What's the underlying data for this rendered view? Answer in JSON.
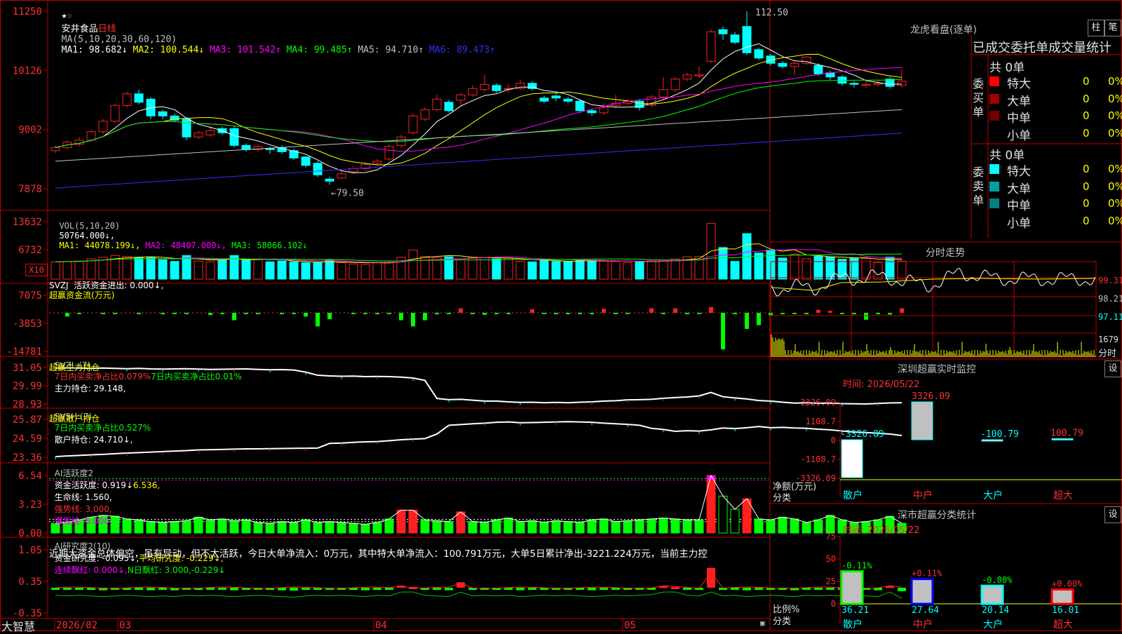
{
  "app": {
    "brand": "大智慧",
    "star_icon": "star-icon"
  },
  "main_chart": {
    "stock_name": "安井食品",
    "period": "日线",
    "ma_params": "MA(5,10,20,30,60,120)",
    "ma": [
      {
        "label": "MA1: 98.682↓",
        "color": "#ffffff"
      },
      {
        "label": "MA2: 100.544↓",
        "color": "#ffff00"
      },
      {
        "label": "MA3: 101.542↑",
        "color": "#ff00ff"
      },
      {
        "label": "MA4: 99.485↑",
        "color": "#00ff00"
      },
      {
        "label": "MA5: 94.710↑",
        "color": "#c0c0c0"
      },
      {
        "label": "MA6: 89.473↑",
        "color": "#3030ff"
      }
    ],
    "y_ticks": [
      "11250",
      "10126",
      "9002",
      "7878"
    ],
    "high_label": "112.50",
    "low_label": "←79.50",
    "colors": {
      "up": "#ff2020",
      "down": "#00ffff"
    }
  },
  "vol_panel": {
    "title": "VOL(5,10,20)",
    "value": "50764.000↓,",
    "ma": [
      {
        "label": "MA1: 44078.199↓,",
        "color": "#ffff00"
      },
      {
        "label": "MA2: 48407.000↓,",
        "color": "#ff00ff"
      },
      {
        "label": "MA3: 58066.102↓",
        "color": "#00ff00"
      }
    ],
    "y_ticks": [
      "13632",
      "6732"
    ],
    "unit": "X10"
  },
  "svzj_panel": {
    "title": "SVZJ  活跃资金进出: 0.000↓,",
    "subtitle": "超赢资金流(万元)",
    "y_ticks": [
      "7075",
      "-3853",
      "-14781"
    ]
  },
  "svzl_panel": {
    "prefix": "SVZL (7)",
    "a": "7日内买卖净占比0.079%",
    "b": "7日内买卖净占比0.01%",
    "c": "主力持仓: 29.148,",
    "subtitle": "超赢主力持仓",
    "y_ticks": [
      "31.05",
      "29.99",
      "28.93"
    ]
  },
  "svsh_panel": {
    "prefix": "SVSH (7)",
    "a": "7日内买卖净占比0.527%",
    "c": "散户持仓: 24.710↓,",
    "subtitle": "超赢散户持仓",
    "y_ticks": [
      "25.87",
      "24.59",
      "23.36"
    ]
  },
  "ai_active_panel": {
    "prefix": "AI活跃度2",
    "a": "资金活跃度: 0.919↓",
    "b": "6.536,",
    "c": "生命线: 1.560,",
    "d": "强势线: 3.000,",
    "e": "爆发线: 6.000,",
    "y_ticks": [
      "6.54",
      "3.23",
      "0.00"
    ]
  },
  "ai_research_panel": {
    "prefix": "AI研究度2(10)",
    "a": "资金研究度: -0.095↓,",
    "b": "平均研究度: -0.229↓,",
    "c": "连续飘红: 0.000↓,",
    "d": "N日飘红: 3.000,",
    "e": "-0.229↓",
    "comment": "近期大资金总体偏空，虽有异动，但不太活跃，今日大单净流入：0万元，其中特大单净流入：100.791万元，大单5日累计净出-3221.224万元，当前主力控",
    "y_ticks": [
      "1.05",
      "0.35",
      "-0.35"
    ]
  },
  "x_axis": {
    "labels": [
      "2026/02",
      "03",
      "04",
      "05"
    ]
  },
  "dragon_tiger": {
    "title": "龙虎看盘(逐单)",
    "btn_a": "柱",
    "btn_b": "笔",
    "header": "已成交委托单成交量统计",
    "buy_title": "委买单",
    "sell_title": "委卖单",
    "buy_total": "共 0单",
    "sell_total": "共 0单",
    "buy_rows": [
      {
        "label": "特大",
        "color": "#ff0000",
        "v": "0",
        "p": "0%"
      },
      {
        "label": "大单",
        "color": "#a00000",
        "v": "0",
        "p": "0%"
      },
      {
        "label": "中单",
        "color": "#700000",
        "v": "0",
        "p": "0%"
      },
      {
        "label": "小单",
        "color": "",
        "v": "0",
        "p": "0%"
      }
    ],
    "sell_rows": [
      {
        "label": "特大",
        "color": "#00ffff",
        "v": "0",
        "p": "0%"
      },
      {
        "label": "大单",
        "color": "#00a0a0",
        "v": "0",
        "p": "0%"
      },
      {
        "label": "中单",
        "color": "#008080",
        "v": "0",
        "p": "0%"
      },
      {
        "label": "小单",
        "color": "",
        "v": "0",
        "p": "0%"
      }
    ]
  },
  "intraday": {
    "title": "分时走势",
    "y_ticks": [
      "99.31",
      "98.21",
      "97.11"
    ],
    "vol_label": "1679",
    "vol_unit": "分时"
  },
  "sz_monitor": {
    "title": "深圳超赢实时监控",
    "btn": "设",
    "time": "时间: 2026/05/22",
    "y_ticks": [
      "3326.09",
      "1108.7",
      "0",
      "-1108.7",
      "-3326.09"
    ],
    "bars": [
      {
        "name": "散户",
        "value": -3326.09,
        "label": "-3326.09"
      },
      {
        "name": "中户",
        "value": 3326.09,
        "label": "3326.09"
      },
      {
        "name": "大户",
        "value": -100.79,
        "label": "-100.79"
      },
      {
        "name": "超大",
        "value": 100.79,
        "label": "100.79"
      }
    ],
    "ylabel": "净额(万元)",
    "xlabel": "分类"
  },
  "sz_class": {
    "title": "深市超赢分类统计",
    "btn": "设",
    "time": "时间: 2026/05/22",
    "y_ticks": [
      "75",
      "50",
      "25",
      "0"
    ],
    "bars": [
      {
        "name": "散户",
        "value": 36.21,
        "label": "36.21",
        "delta": "-0.11%",
        "color": "#00ff00"
      },
      {
        "name": "中户",
        "value": 27.64,
        "label": "27.64",
        "delta": "+0.11%",
        "color": "#0000ff"
      },
      {
        "name": "大户",
        "value": 20.14,
        "label": "20.14",
        "delta": "-0.00%",
        "color": "#00ffff"
      },
      {
        "name": "超大",
        "value": 16.01,
        "label": "16.01",
        "delta": "+0.00%",
        "color": "#ff0000"
      }
    ],
    "ylabel": "比例%",
    "xlabel": "分类"
  },
  "chart_data": [
    {
      "type": "candlestick",
      "title": "安井食品 日线",
      "ylim": [
        7878,
        11250
      ],
      "candles": [
        [
          86.0,
          86.6,
          87.0,
          85.6
        ],
        [
          86.6,
          87.6,
          88.0,
          86.2
        ],
        [
          87.2,
          88.0,
          88.6,
          86.8
        ],
        [
          88.0,
          89.6,
          90.0,
          87.6
        ],
        [
          89.6,
          91.6,
          92.0,
          89.2
        ],
        [
          91.6,
          94.6,
          95.0,
          91.2
        ],
        [
          94.6,
          96.8,
          97.2,
          94.2
        ],
        [
          96.8,
          95.2,
          97.6,
          94.8
        ],
        [
          95.8,
          92.6,
          96.2,
          92.0
        ],
        [
          93.4,
          92.6,
          93.8,
          92.0
        ],
        [
          92.6,
          91.8,
          93.0,
          91.4
        ],
        [
          92.0,
          88.6,
          92.4,
          88.0
        ],
        [
          88.6,
          89.4,
          89.8,
          88.2
        ],
        [
          89.0,
          89.8,
          90.6,
          88.6
        ],
        [
          90.2,
          89.4,
          90.6,
          89.0
        ],
        [
          90.2,
          87.0,
          90.6,
          86.6
        ],
        [
          87.0,
          86.2,
          87.4,
          85.8
        ],
        [
          86.2,
          86.8,
          87.2,
          85.8
        ],
        [
          86.4,
          86.2,
          86.8,
          85.4
        ],
        [
          86.6,
          85.8,
          87.0,
          85.4
        ],
        [
          86.0,
          84.6,
          86.4,
          84.2
        ],
        [
          84.8,
          83.2,
          85.0,
          82.8
        ],
        [
          83.6,
          81.4,
          84.0,
          81.0
        ],
        [
          80.6,
          80.2,
          81.0,
          79.5
        ],
        [
          80.8,
          81.6,
          82.2,
          80.6
        ],
        [
          82.0,
          82.6,
          83.0,
          81.6
        ],
        [
          82.6,
          83.4,
          83.8,
          82.2
        ],
        [
          83.6,
          84.0,
          84.4,
          83.2
        ],
        [
          84.4,
          86.8,
          87.2,
          84.0
        ],
        [
          87.0,
          88.6,
          89.0,
          86.6
        ],
        [
          89.4,
          92.6,
          93.0,
          89.0
        ],
        [
          92.0,
          93.8,
          94.2,
          91.6
        ],
        [
          93.8,
          95.8,
          96.6,
          93.4
        ],
        [
          95.2,
          93.6,
          95.6,
          93.2
        ],
        [
          95.6,
          96.6,
          97.0,
          94.6
        ],
        [
          96.6,
          97.8,
          98.4,
          96.2
        ],
        [
          97.6,
          98.6,
          100.4,
          97.2
        ],
        [
          98.4,
          97.4,
          98.8,
          97.0
        ],
        [
          97.8,
          97.8,
          98.6,
          97.0
        ],
        [
          97.8,
          98.8,
          99.4,
          97.6
        ],
        [
          98.8,
          97.8,
          99.2,
          97.4
        ],
        [
          96.0,
          95.4,
          96.4,
          95.0
        ],
        [
          96.4,
          96.0,
          96.8,
          95.4
        ],
        [
          95.8,
          95.4,
          96.2,
          95.0
        ],
        [
          95.4,
          93.6,
          95.8,
          93.2
        ],
        [
          93.6,
          93.2,
          94.0,
          92.6
        ],
        [
          93.2,
          94.2,
          95.0,
          92.8
        ],
        [
          94.6,
          95.0,
          96.6,
          94.0
        ],
        [
          95.0,
          95.4,
          95.8,
          94.6
        ],
        [
          95.4,
          94.2,
          95.8,
          93.6
        ],
        [
          94.6,
          96.2,
          96.6,
          94.2
        ],
        [
          96.2,
          97.6,
          100.0,
          95.8
        ],
        [
          97.6,
          99.6,
          100.0,
          97.2
        ],
        [
          99.6,
          100.4,
          100.8,
          99.2
        ],
        [
          100.2,
          100.4,
          102.0,
          99.8
        ],
        [
          103.0,
          108.6,
          109.0,
          102.6
        ],
        [
          109.0,
          108.2,
          109.6,
          107.0
        ],
        [
          108.0,
          106.6,
          108.6,
          106.2
        ],
        [
          109.6,
          104.6,
          112.5,
          104.2
        ],
        [
          105.2,
          103.6,
          105.6,
          103.2
        ],
        [
          104.0,
          102.6,
          104.4,
          102.2
        ],
        [
          102.6,
          102.0,
          103.0,
          101.6
        ],
        [
          102.0,
          102.6,
          103.0,
          100.4
        ],
        [
          102.6,
          103.8,
          104.0,
          102.2
        ],
        [
          102.2,
          100.6,
          102.6,
          100.2
        ],
        [
          100.8,
          100.0,
          101.2,
          99.4
        ],
        [
          100.0,
          98.8,
          100.4,
          98.4
        ],
        [
          98.8,
          98.6,
          99.2,
          98.0
        ],
        [
          98.4,
          98.6,
          99.2,
          97.8
        ],
        [
          98.6,
          98.8,
          99.4,
          98.2
        ],
        [
          99.6,
          98.2,
          100.0,
          97.8
        ],
        [
          98.4,
          99.2,
          101.4,
          98.0
        ]
      ]
    },
    {
      "type": "bar",
      "title": "VOL",
      "ylim": [
        0,
        13632
      ],
      "values": [
        4100,
        4200,
        4300,
        4800,
        5200,
        5600,
        5400,
        5100,
        5200,
        4600,
        4200,
        5600,
        4300,
        4100,
        4500,
        5600,
        4500,
        4600,
        4100,
        4300,
        4100,
        3900,
        3900,
        4500,
        3900,
        3600,
        3500,
        3900,
        4300,
        5200,
        6900,
        5400,
        5100,
        5300,
        4800,
        5200,
        5100,
        4800,
        5000,
        4200,
        4100,
        4500,
        4200,
        4100,
        4600,
        4400,
        4300,
        4200,
        3900,
        4200,
        4300,
        4500,
        4800,
        5300,
        5400,
        13200,
        7500,
        4200,
        10800,
        6200,
        6900,
        5000,
        5900,
        4800,
        5400,
        5300,
        4700,
        5000,
        4900,
        3900,
        5200,
        4300
      ]
    },
    {
      "type": "bar",
      "title": "超赢资金流(万元)",
      "ylim": [
        -14781,
        7075
      ],
      "values": [
        0,
        -1500,
        -400,
        0,
        -500,
        -400,
        0,
        -500,
        0,
        -600,
        -400,
        -500,
        0,
        -900,
        -200,
        -3000,
        -400,
        -300,
        0,
        -600,
        -200,
        -1500,
        -5500,
        -2600,
        0,
        -400,
        -300,
        -600,
        -500,
        -3000,
        -5500,
        -3000,
        -600,
        -500,
        1800,
        -500,
        -800,
        -400,
        -500,
        0,
        1400,
        -400,
        -600,
        -300,
        -500,
        -600,
        1600,
        -300,
        -500,
        0,
        1800,
        -400,
        1800,
        -300,
        -500,
        2300,
        -14781,
        -600,
        -6500,
        -5000,
        -1000,
        -500,
        -400,
        -500,
        1200,
        800,
        -400,
        -600,
        -2800,
        -600,
        -700,
        1800
      ]
    },
    {
      "type": "line",
      "title": "超赢主力持仓",
      "ylim": [
        28.93,
        31.05
      ],
      "values": [
        31.02,
        31.03,
        31.02,
        31.0,
        31.02,
        31.0,
        30.98,
        31.0,
        30.97,
        30.96,
        30.97,
        30.98,
        30.96,
        30.94,
        30.95,
        30.96,
        30.97,
        30.94,
        30.92,
        30.93,
        30.9,
        30.78,
        30.6,
        30.56,
        30.54,
        30.55,
        30.52,
        30.53,
        30.52,
        30.49,
        30.44,
        30.3,
        29.25,
        29.18,
        29.2,
        29.15,
        29.1,
        29.1,
        29.05,
        29.02,
        29.03,
        29.0,
        29.02,
        29.0,
        29.03,
        29.05,
        29.1,
        29.12,
        29.17,
        29.18,
        29.2,
        29.26,
        29.3,
        29.34,
        29.4,
        29.6,
        29.35,
        29.28,
        29.22,
        29.13,
        29.1,
        29.03,
        28.98,
        29.0,
        28.97,
        28.98,
        28.95,
        28.94,
        28.93,
        28.96,
        28.99,
        29.0
      ]
    },
    {
      "type": "line",
      "title": "超赢散户持仓",
      "ylim": [
        23.36,
        25.87
      ],
      "values": [
        23.4,
        23.45,
        23.48,
        23.52,
        23.55,
        23.6,
        23.64,
        23.67,
        23.7,
        23.74,
        23.77,
        23.8,
        23.85,
        23.86,
        23.88,
        23.9,
        23.92,
        23.92,
        23.93,
        23.94,
        23.95,
        23.96,
        23.97,
        24.28,
        24.3,
        24.35,
        24.38,
        24.4,
        24.46,
        24.52,
        24.56,
        24.6,
        24.9,
        25.48,
        25.53,
        25.58,
        25.62,
        25.68,
        25.7,
        25.65,
        25.66,
        25.68,
        25.7,
        25.72,
        25.7,
        25.68,
        25.62,
        25.58,
        25.54,
        25.48,
        25.28,
        25.2,
        25.08,
        25.12,
        25.1,
        25.18,
        25.3,
        25.26,
        25.32,
        25.4,
        25.32,
        25.34,
        25.3,
        25.28,
        25.22,
        25.18,
        25.1,
        25.03,
        25.0,
        24.95,
        24.9,
        24.8
      ]
    },
    {
      "type": "bar",
      "title": "AI活跃度2",
      "ylim": [
        0,
        6.54
      ],
      "values": [
        1.1,
        1.2,
        1.5,
        1.8,
        2.0,
        1.9,
        1.6,
        1.5,
        1.3,
        1.2,
        1.3,
        1.4,
        1.8,
        1.5,
        1.6,
        1.4,
        1.5,
        1.2,
        1.1,
        1.3,
        1.2,
        1.5,
        1.2,
        1.3,
        1.2,
        1.1,
        1.0,
        1.2,
        1.6,
        2.6,
        2.6,
        1.5,
        1.4,
        1.3,
        2.4,
        1.3,
        1.2,
        1.5,
        1.7,
        1.3,
        1.4,
        1.2,
        1.4,
        1.3,
        1.2,
        1.5,
        1.6,
        1.3,
        1.4,
        1.5,
        1.6,
        1.7,
        1.6,
        1.5,
        1.5,
        6.54,
        4.2,
        2.7,
        3.9,
        1.6,
        1.5,
        1.8,
        1.6,
        1.2,
        1.5,
        2.0,
        1.5,
        1.2,
        1.3,
        1.5,
        1.9,
        1.1
      ]
    },
    {
      "type": "bar",
      "title": "AI研究度2(10)",
      "ylim": [
        -0.35,
        1.05
      ],
      "values": [
        -0.05,
        -0.06,
        -0.05,
        -0.06,
        -0.07,
        -0.06,
        -0.05,
        -0.06,
        -0.07,
        -0.06,
        -0.07,
        -0.05,
        -0.06,
        -0.05,
        -0.06,
        -0.07,
        -0.06,
        -0.05,
        -0.06,
        -0.07,
        -0.08,
        -0.06,
        -0.05,
        -0.06,
        -0.05,
        -0.06,
        -0.07,
        -0.05,
        -0.06,
        0.06,
        0.02,
        -0.05,
        -0.06,
        -0.07,
        0.15,
        -0.06,
        -0.05,
        -0.06,
        -0.05,
        -0.07,
        -0.06,
        -0.05,
        -0.06,
        -0.05,
        -0.06,
        -0.07,
        -0.06,
        -0.05,
        -0.06,
        -0.05,
        -0.04,
        0.05,
        0.02,
        -0.05,
        -0.06,
        0.55,
        -0.06,
        -0.05,
        -0.07,
        -0.06,
        -0.05,
        -0.06,
        -0.07,
        -0.05,
        -0.06,
        -0.05,
        -0.06,
        -0.05,
        -0.06,
        -0.07,
        0.05,
        -0.095
      ]
    }
  ]
}
